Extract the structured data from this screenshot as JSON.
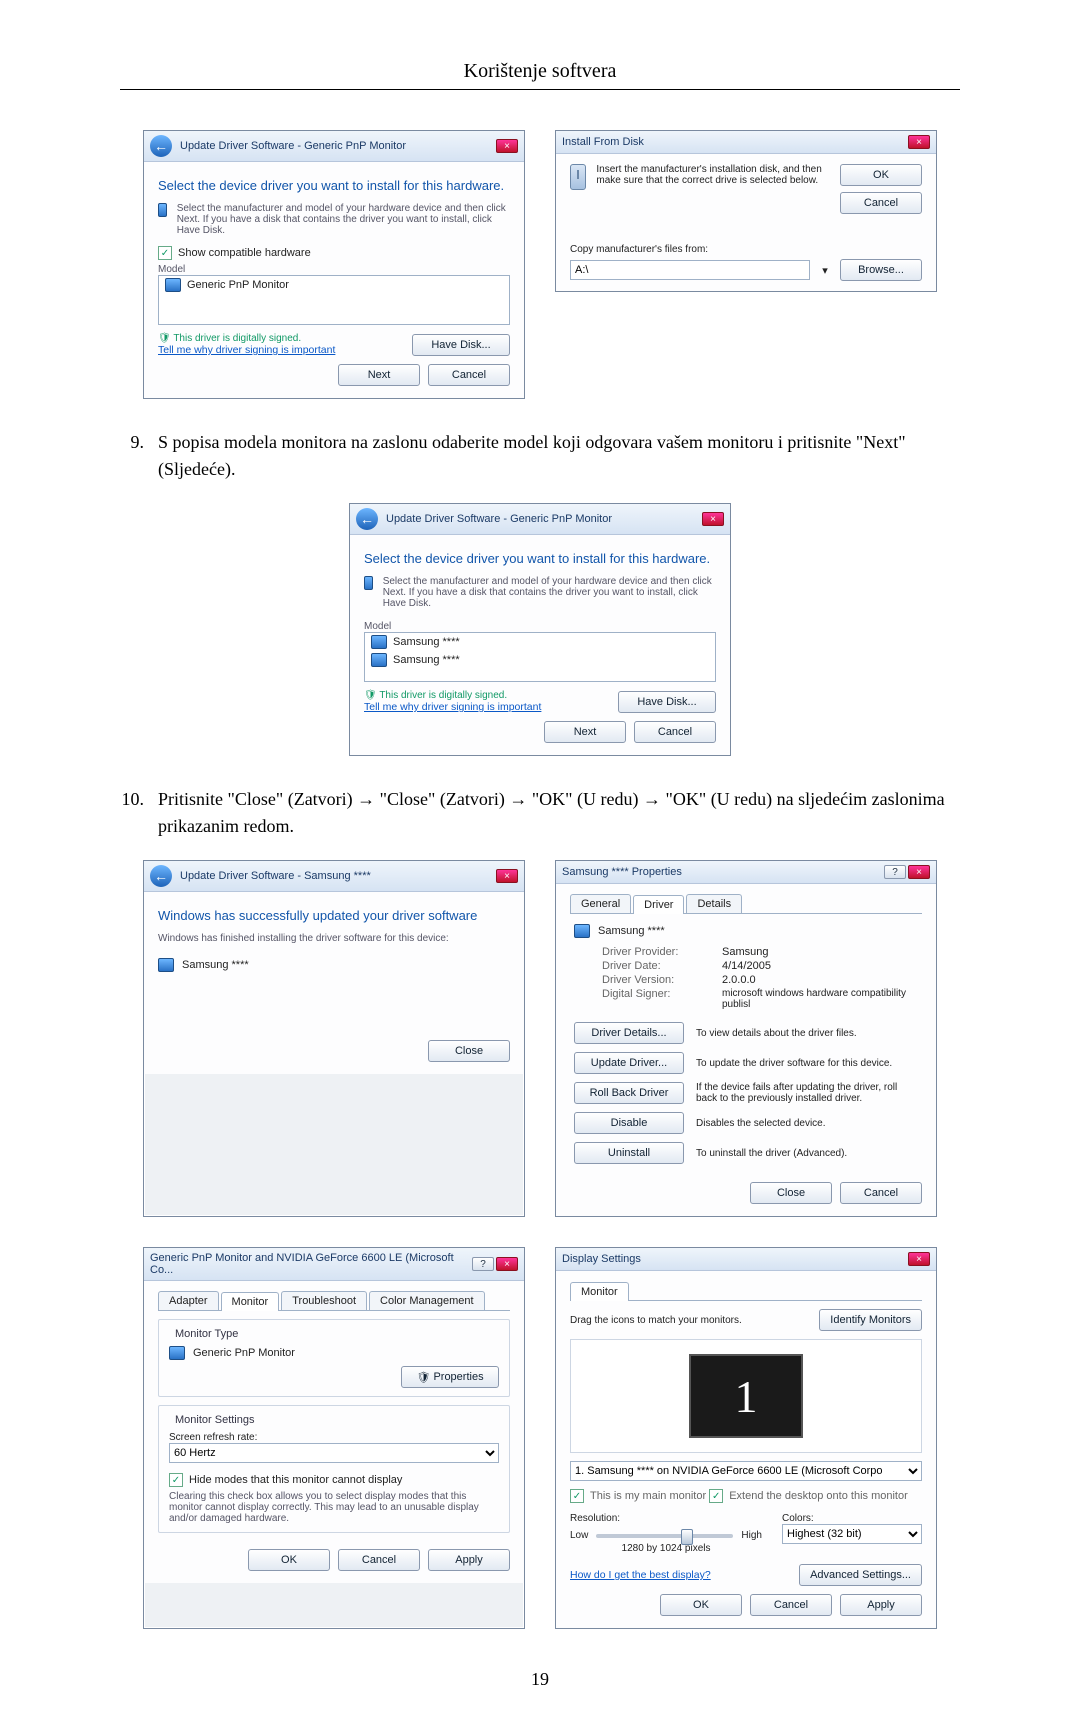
{
  "page": {
    "header": "Korištenje softvera",
    "number": "19"
  },
  "step9": {
    "num": "9.",
    "text": "S popisa modela monitora na zaslonu odaberite model koji odgovara vašem monitoru i pritisnite \"Next\" (Sljedeće)."
  },
  "step10": {
    "num": "10.",
    "text": "Pritisnite \"Close\" (Zatvori) → \"Close\" (Zatvori) → \"OK\" (U redu) → \"OK\" (U redu) na sljedećim zaslonima prikazanim redom."
  },
  "dlg_update1": {
    "title": "Update Driver Software - Generic PnP Monitor",
    "heading": "Select the device driver you want to install for this hardware.",
    "desc": "Select the manufacturer and model of your hardware device and then click Next. If you have a disk that contains the driver you want to install, click Have Disk.",
    "show_compat_label": "Show compatible hardware",
    "model_label": "Model",
    "model_item": "Generic PnP Monitor",
    "signed": "This driver is digitally signed.",
    "signed_link": "Tell me why driver signing is important",
    "have_disk": "Have Disk...",
    "next": "Next",
    "cancel": "Cancel"
  },
  "dlg_install_disk": {
    "title": "Install From Disk",
    "desc": "Insert the manufacturer's installation disk, and then make sure that the correct drive is selected below.",
    "ok": "OK",
    "cancel": "Cancel",
    "copy_label": "Copy manufacturer's files from:",
    "path": "A:\\",
    "browse": "Browse..."
  },
  "dlg_update2": {
    "title": "Update Driver Software - Generic PnP Monitor",
    "heading": "Select the device driver you want to install for this hardware.",
    "desc": "Select the manufacturer and model of your hardware device and then click Next. If you have a disk that contains the driver you want to install, click Have Disk.",
    "model_label": "Model",
    "model_item1": "Samsung ****",
    "model_item2": "Samsung ****",
    "signed": "This driver is digitally signed.",
    "signed_link": "Tell me why driver signing is important",
    "have_disk": "Have Disk...",
    "next": "Next",
    "cancel": "Cancel"
  },
  "dlg_finished": {
    "title": "Update Driver Software - Samsung ****",
    "heading": "Windows has successfully updated your driver software",
    "sub": "Windows has finished installing the driver software for this device:",
    "device": "Samsung ****",
    "close": "Close"
  },
  "dlg_driverprops": {
    "title": "Samsung **** Properties",
    "tabs": {
      "general": "General",
      "driver": "Driver",
      "details": "Details"
    },
    "device": "Samsung ****",
    "provider_l": "Driver Provider:",
    "provider_v": "Samsung",
    "date_l": "Driver Date:",
    "date_v": "4/14/2005",
    "version_l": "Driver Version:",
    "version_v": "2.0.0.0",
    "signer_l": "Digital Signer:",
    "signer_v": "microsoft windows hardware compatibility publisl",
    "btn_details": "Driver Details...",
    "desc_details": "To view details about the driver files.",
    "btn_update": "Update Driver...",
    "desc_update": "To update the driver software for this device.",
    "btn_rollback": "Roll Back Driver",
    "desc_rollback": "If the device fails after updating the driver, roll back to the previously installed driver.",
    "btn_disable": "Disable",
    "desc_disable": "Disables the selected device.",
    "btn_uninstall": "Uninstall",
    "desc_uninstall": "To uninstall the driver (Advanced).",
    "close": "Close",
    "cancel": "Cancel"
  },
  "dlg_monadapter": {
    "title": "Generic PnP Monitor and NVIDIA GeForce 6600 LE (Microsoft Co...",
    "tabs": {
      "adapter": "Adapter",
      "monitor": "Monitor",
      "troubleshoot": "Troubleshoot",
      "color": "Color Management"
    },
    "type_legend": "Monitor Type",
    "type_value": "Generic PnP Monitor",
    "properties": "Properties",
    "settings_legend": "Monitor Settings",
    "refresh_label": "Screen refresh rate:",
    "refresh_value": "60 Hertz",
    "hide_label": "Hide modes that this monitor cannot display",
    "hide_desc": "Clearing this check box allows you to select display modes that this monitor cannot display correctly. This may lead to an unusable display and/or damaged hardware.",
    "ok": "OK",
    "cancel": "Cancel",
    "apply": "Apply"
  },
  "dlg_display": {
    "title": "Display Settings",
    "tab": "Monitor",
    "drag": "Drag the icons to match your monitors.",
    "identify": "Identify Monitors",
    "number": "1",
    "combo": "1. Samsung **** on NVIDIA GeForce 6600 LE (Microsoft Corpo",
    "main": "This is my main monitor",
    "extend": "Extend the desktop onto this monitor",
    "res_label": "Resolution:",
    "low": "Low",
    "high": "High",
    "res_value": "1280 by 1024 pixels",
    "colors_label": "Colors:",
    "colors_value": "Highest (32 bit)",
    "best_link": "How do I get the best display?",
    "advanced": "Advanced Settings...",
    "ok": "OK",
    "cancel": "Cancel",
    "apply": "Apply"
  }
}
